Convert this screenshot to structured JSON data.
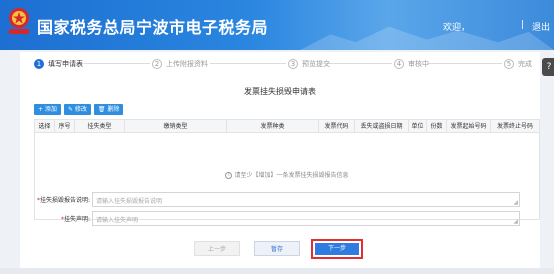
{
  "header": {
    "title": "国家税务总局宁波市电子税务局",
    "user": "欢迎，",
    "separator": "|",
    "exit": "退出"
  },
  "steps": [
    {
      "num": "1",
      "label": "填写申请表"
    },
    {
      "num": "2",
      "label": "上传附报资料"
    },
    {
      "num": "3",
      "label": "预览提交"
    },
    {
      "num": "4",
      "label": "审核中"
    },
    {
      "num": "5",
      "label": "完成"
    }
  ],
  "help": "?",
  "form": {
    "title": "发票挂失损毁申请表",
    "toolbar": {
      "add": "+ 添加",
      "edit": "✎ 修改",
      "delete": "🗑 删除"
    },
    "columns": [
      "选择",
      "序号",
      "挂失类型",
      "缴销类型",
      "发票种类",
      "发票代码",
      "丢失或盗损日期",
      "单位",
      "份数",
      "发票起始号码",
      "发票终止号码"
    ],
    "empty_msg": "请至少【增加】一条发票挂失损毁报告信息"
  },
  "fields": {
    "reason_label": "挂失损毁报告说明:",
    "reason_placeholder": "请输入挂失损毁报告说明",
    "statement_label": "挂失声明:",
    "statement_placeholder": "请输入挂失声明",
    "required_mark": "*"
  },
  "actions": {
    "prev": "上一步",
    "save": "暂存",
    "next": "下一步"
  }
}
